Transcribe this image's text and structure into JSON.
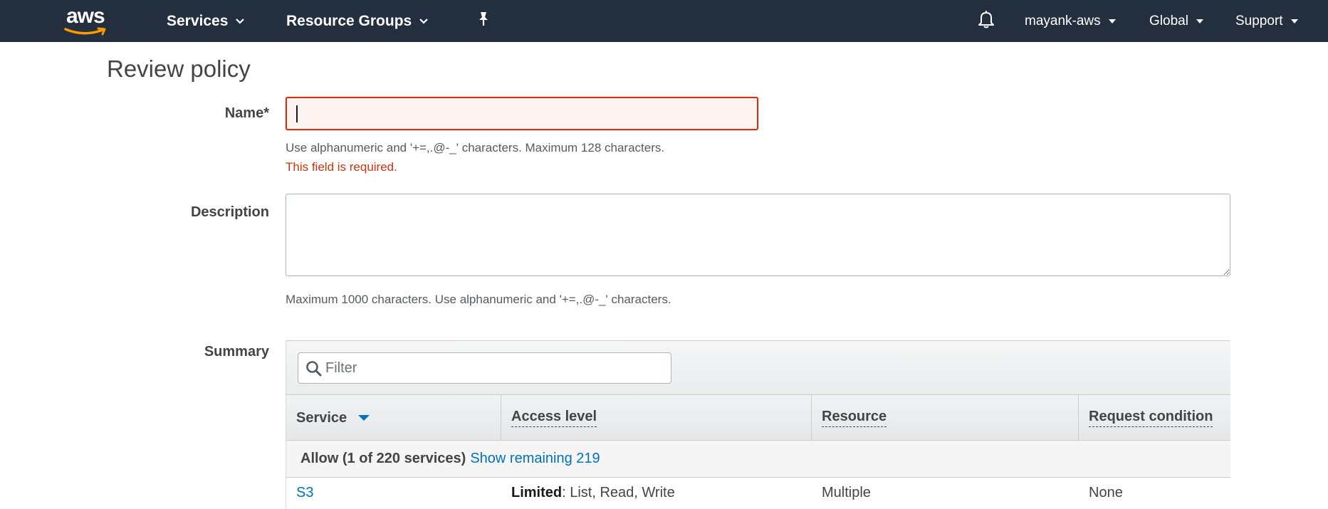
{
  "nav": {
    "logo_text": "aws",
    "services": "Services",
    "resource_groups": "Resource Groups",
    "user": "mayank-aws",
    "region": "Global",
    "support": "Support"
  },
  "page": {
    "title": "Review policy"
  },
  "form": {
    "name_label": "Name*",
    "name_value": "",
    "name_hint": "Use alphanumeric and '+=,.@-_' characters. Maximum 128 characters.",
    "name_error": "This field is required.",
    "description_label": "Description",
    "description_value": "",
    "description_hint": "Maximum 1000 characters. Use alphanumeric and '+=,.@-_' characters.",
    "summary_label": "Summary"
  },
  "summary": {
    "filter_placeholder": "Filter",
    "columns": [
      "Service",
      "Access level",
      "Resource",
      "Request condition"
    ],
    "group": {
      "label": "Allow (1 of 220 services)",
      "link": "Show remaining 219"
    },
    "rows": [
      {
        "service": "S3",
        "access_level_strong": "Limited",
        "access_level_rest": ": List, Read, Write",
        "resource": "Multiple",
        "request_condition": "None"
      }
    ]
  },
  "colors": {
    "nav_bg": "#232f3e",
    "aws_orange": "#ff9900",
    "error": "#d13212",
    "link": "#0073bb"
  }
}
